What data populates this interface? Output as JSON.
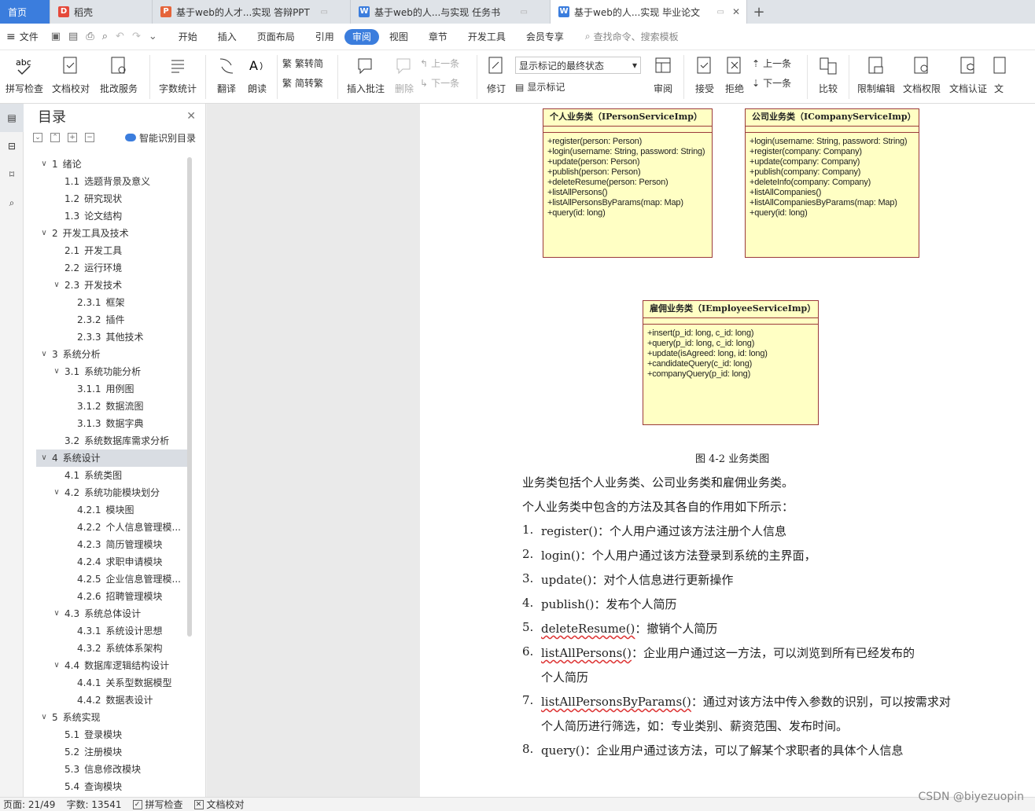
{
  "tabs": {
    "home": "首页",
    "docer": "稻壳",
    "tab1": "基于web的人才...实现 答辩PPT",
    "tab2": "基于web的人...与实现 任务书",
    "active": "基于web的人...实现 毕业论文"
  },
  "menu": {
    "file": "文件",
    "items": [
      "开始",
      "插入",
      "页面布局",
      "引用",
      "审阅",
      "视图",
      "章节",
      "开发工具",
      "会员专享"
    ],
    "search": "查找命令、搜索模板"
  },
  "ribbon": {
    "spell": "拼写检查",
    "proof": "文档校对",
    "batch": "批改服务",
    "wordcount": "字数统计",
    "translate": "翻译",
    "read": "朗读",
    "to_trad": "繁转简",
    "to_simp": "简转繁",
    "insert_comment": "插入批注",
    "delete": "删除",
    "prev_comment": "上一条",
    "next_comment": "下一条",
    "track": "修订",
    "markup_mode": "显示标记的最终状态",
    "show_markup": "显示标记",
    "review": "审阅",
    "accept": "接受",
    "reject": "拒绝",
    "prev": "上一条",
    "next": "下一条",
    "compare": "比较",
    "restrict": "限制编辑",
    "permission": "文档权限",
    "certify": "文档认证",
    "more": "文"
  },
  "toc": {
    "title": "目录",
    "smart": "智能识别目录",
    "items": [
      {
        "level": 1,
        "num": "1",
        "text": "绪论",
        "caret": true
      },
      {
        "level": 2,
        "num": "1.1",
        "text": "选题背景及意义",
        "caret": false
      },
      {
        "level": 2,
        "num": "1.2",
        "text": "研究现状",
        "caret": false
      },
      {
        "level": 2,
        "num": "1.3",
        "text": "论文结构",
        "caret": false
      },
      {
        "level": 1,
        "num": "2",
        "text": "开发工具及技术",
        "caret": true
      },
      {
        "level": 2,
        "num": "2.1",
        "text": "开发工具",
        "caret": false
      },
      {
        "level": 2,
        "num": "2.2",
        "text": "运行环境",
        "caret": false
      },
      {
        "level": 2,
        "num": "2.3",
        "text": "开发技术",
        "caret": true
      },
      {
        "level": 3,
        "num": "2.3.1",
        "text": "框架",
        "caret": false
      },
      {
        "level": 3,
        "num": "2.3.2",
        "text": "插件",
        "caret": false
      },
      {
        "level": 3,
        "num": "2.3.3",
        "text": "其他技术",
        "caret": false
      },
      {
        "level": 1,
        "num": "3",
        "text": "系统分析",
        "caret": true
      },
      {
        "level": 2,
        "num": "3.1",
        "text": "系统功能分析",
        "caret": true
      },
      {
        "level": 3,
        "num": "3.1.1",
        "text": "用例图",
        "caret": false
      },
      {
        "level": 3,
        "num": "3.1.2",
        "text": "数据流图",
        "caret": false
      },
      {
        "level": 3,
        "num": "3.1.3",
        "text": "数据字典",
        "caret": false
      },
      {
        "level": 2,
        "num": "3.2",
        "text": "系统数据库需求分析",
        "caret": false
      },
      {
        "level": 1,
        "num": "4",
        "text": "系统设计",
        "caret": true,
        "selected": true
      },
      {
        "level": 2,
        "num": "4.1",
        "text": "系统类图",
        "caret": false
      },
      {
        "level": 2,
        "num": "4.2",
        "text": "系统功能模块划分",
        "caret": true
      },
      {
        "level": 3,
        "num": "4.2.1",
        "text": "模块图",
        "caret": false
      },
      {
        "level": 3,
        "num": "4.2.2",
        "text": "个人信息管理模...",
        "caret": false
      },
      {
        "level": 3,
        "num": "4.2.3",
        "text": "简历管理模块",
        "caret": false
      },
      {
        "level": 3,
        "num": "4.2.4",
        "text": "求职申请模块",
        "caret": false
      },
      {
        "level": 3,
        "num": "4.2.5",
        "text": "企业信息管理模...",
        "caret": false
      },
      {
        "level": 3,
        "num": "4.2.6",
        "text": "招聘管理模块",
        "caret": false
      },
      {
        "level": 2,
        "num": "4.3",
        "text": "系统总体设计",
        "caret": true
      },
      {
        "level": 3,
        "num": "4.3.1",
        "text": "系统设计思想",
        "caret": false
      },
      {
        "level": 3,
        "num": "4.3.2",
        "text": "系统体系架构",
        "caret": false
      },
      {
        "level": 2,
        "num": "4.4",
        "text": "数据库逻辑结构设计",
        "caret": true
      },
      {
        "level": 3,
        "num": "4.4.1",
        "text": "关系型数据模型",
        "caret": false
      },
      {
        "level": 3,
        "num": "4.4.2",
        "text": "数据表设计",
        "caret": false
      },
      {
        "level": 1,
        "num": "5",
        "text": "系统实现",
        "caret": true
      },
      {
        "level": 2,
        "num": "5.1",
        "text": "登录模块",
        "caret": false
      },
      {
        "level": 2,
        "num": "5.2",
        "text": "注册模块",
        "caret": false
      },
      {
        "level": 2,
        "num": "5.3",
        "text": "信息修改模块",
        "caret": false
      },
      {
        "level": 2,
        "num": "5.4",
        "text": "查询模块",
        "caret": false
      }
    ]
  },
  "document": {
    "uml": [
      {
        "title": "个人业务类（IPersonServiceImp）",
        "methods": [
          "+register(person: Person)",
          "+login(username: String, password: String)",
          "+update(person: Person)",
          "+publish(person: Person)",
          "+deleteResume(person: Person)",
          "+listAllPersons()",
          "+listAllPersonsByParams(map: Map)",
          "+query(id: long)"
        ]
      },
      {
        "title": "公司业务类（ICompanyServiceImp）",
        "methods": [
          "+login(username: String, password: String)",
          "+register(company: Company)",
          "+update(company: Company)",
          "+publish(company: Company)",
          "+deleteInfo(company: Company)",
          "+listAllCompanies()",
          "+listAllCompaniesByParams(map: Map)",
          "+query(id: long)"
        ]
      },
      {
        "title": "雇佣业务类（IEmployeeServiceImp）",
        "methods": [
          "+insert(p_id: long, c_id: long)",
          "+query(p_id: long, c_id: long)",
          "+update(isAgreed: long, id: long)",
          "+candidateQuery(c_id: long)",
          "+companyQuery(p_id: long)"
        ]
      }
    ],
    "caption": "图 4-2 业务类图",
    "para1": "业务类包括个人业务类、公司业务类和雇佣业务类。",
    "para2": "个人业务类中包含的方法及其各自的作用如下所示：",
    "list": [
      {
        "n": "1.",
        "code": "register()",
        "text": "：个人用户通过该方法注册个人信息"
      },
      {
        "n": "2.",
        "code": "login()",
        "text": "：个人用户通过该方法登录到系统的主界面，"
      },
      {
        "n": "3.",
        "code": "update()",
        "text": "：对个人信息进行更新操作"
      },
      {
        "n": "4.",
        "code": "publish()",
        "text": "：发布个人简历"
      },
      {
        "n": "5.",
        "code": "deleteResume()",
        "text": "：撤销个人简历"
      },
      {
        "n": "6.",
        "code": "listAllPersons()",
        "text": "：企业用户通过这一方法，可以浏览到所有已经发布的",
        "cont": "个人简历"
      },
      {
        "n": "7.",
        "code": "listAllPersonsByParams()",
        "text": "：通过对该方法中传入参数的识别，可以按需求对",
        "cont": "个人简历进行筛选，如：专业类别、薪资范围、发布时间。"
      },
      {
        "n": "8.",
        "code": "query()",
        "text": "：企业用户通过该方法，可以了解某个求职者的具体个人信息"
      }
    ]
  },
  "status": {
    "page": "页面: 21/49",
    "words": "字数: 13541",
    "spell": "拼写检查",
    "proof": "文档校对"
  },
  "watermark": "CSDN @biyezuopin"
}
